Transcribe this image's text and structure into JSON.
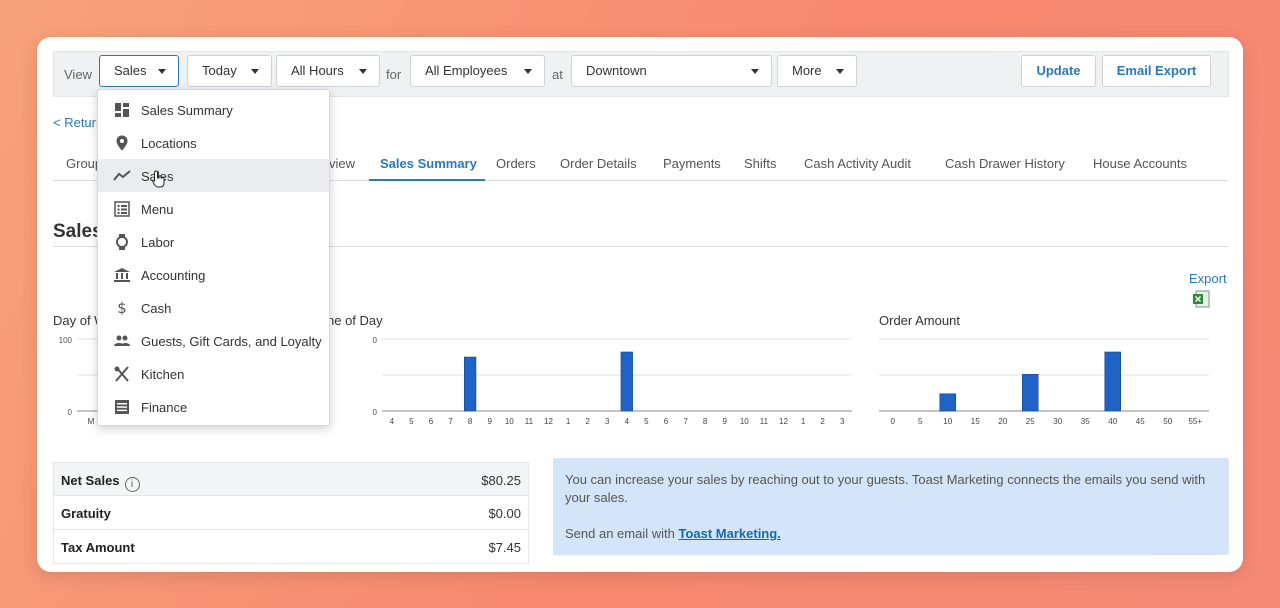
{
  "filters": {
    "view_label": "View",
    "view_value": "Sales",
    "date_value": "Today",
    "hours_value": "All Hours",
    "for_label": "for",
    "employees_value": "All Employees",
    "at_label": "at",
    "location_value": "Downtown",
    "more_label": "More",
    "update_label": "Update",
    "email_export_label": "Email Export"
  },
  "return_link": "< Return",
  "tabs": [
    {
      "label": "Group"
    },
    {
      "label": "view"
    },
    {
      "label": "Sales Summary"
    },
    {
      "label": "Orders"
    },
    {
      "label": "Order Details"
    },
    {
      "label": "Payments"
    },
    {
      "label": "Shifts"
    },
    {
      "label": "Cash Activity Audit"
    },
    {
      "label": "Cash Drawer History"
    },
    {
      "label": "House Accounts"
    }
  ],
  "section_title": "Sales",
  "export_label": "Export",
  "dropdown": {
    "items": [
      {
        "label": "Sales Summary",
        "icon": "dashboard-icon"
      },
      {
        "label": "Locations",
        "icon": "map-pin-icon"
      },
      {
        "label": "Sales",
        "icon": "trend-line-icon"
      },
      {
        "label": "Menu",
        "icon": "menu-list-icon"
      },
      {
        "label": "Labor",
        "icon": "watch-icon"
      },
      {
        "label": "Accounting",
        "icon": "bank-icon"
      },
      {
        "label": "Cash",
        "icon": "dollar-icon"
      },
      {
        "label": "Guests, Gift Cards, and Loyalty",
        "icon": "people-icon"
      },
      {
        "label": "Kitchen",
        "icon": "utensils-icon"
      },
      {
        "label": "Finance",
        "icon": "ledger-icon"
      }
    ]
  },
  "chart_data": [
    {
      "type": "bar",
      "title": "Day of W",
      "yticks": [
        "100",
        "0"
      ],
      "categories": [
        "M"
      ],
      "values": [
        0
      ],
      "ylim": [
        0,
        100
      ]
    },
    {
      "type": "bar",
      "title": "ne of Day",
      "yticks": [
        "0",
        "0"
      ],
      "categories": [
        "4",
        "5",
        "6",
        "7",
        "8",
        "9",
        "10",
        "11",
        "12",
        "1",
        "2",
        "3",
        "4",
        "5",
        "6",
        "7",
        "8",
        "9",
        "10",
        "11",
        "12",
        "1",
        "2",
        "3"
      ],
      "values": [
        0,
        0,
        0,
        0,
        75,
        0,
        0,
        0,
        0,
        0,
        0,
        0,
        82,
        0,
        0,
        0,
        0,
        0,
        0,
        0,
        0,
        0,
        0,
        0
      ],
      "ylim": [
        0,
        100
      ]
    },
    {
      "type": "bar",
      "title": "Order Amount",
      "categories": [
        "0",
        "5",
        "10",
        "15",
        "20",
        "25",
        "30",
        "35",
        "40",
        "45",
        "50",
        "55+"
      ],
      "values": [
        0,
        0,
        24,
        0,
        0,
        51,
        0,
        0,
        82,
        0,
        0,
        0
      ],
      "ylim": [
        0,
        100
      ]
    }
  ],
  "summary": [
    {
      "label": "Net Sales",
      "value": "$80.25",
      "info": "i"
    },
    {
      "label": "Gratuity",
      "value": "$0.00"
    },
    {
      "label": "Tax Amount",
      "value": "$7.45"
    }
  ],
  "promo": {
    "text": "You can increase your sales by reaching out to your guests. Toast Marketing connects the emails you send with your sales.",
    "cta_prefix": "Send an email with",
    "cta_link": "Toast Marketing."
  },
  "colors": {
    "accent": "#2a7ab8",
    "bar": "#1f63c6"
  }
}
